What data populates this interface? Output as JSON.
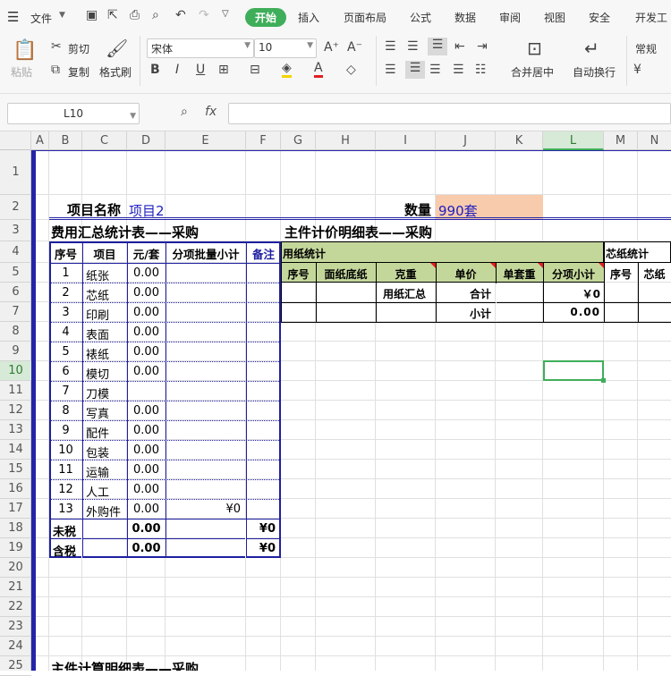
{
  "ribbon": {
    "file_menu": "文件",
    "tabs": [
      "开始",
      "插入",
      "页面布局",
      "公式",
      "数据",
      "审阅",
      "视图",
      "安全",
      "开发工"
    ],
    "paste_label": "粘贴",
    "cut_label": "剪切",
    "copy_label": "复制",
    "format_painter_label": "格式刷",
    "font_name": "宋体",
    "font_size": "10",
    "merge_label": "合并居中",
    "wrap_label": "自动换行",
    "number_format": "常规"
  },
  "formula_bar": {
    "name_box": "L10",
    "fx": "fx",
    "formula": ""
  },
  "columns": [
    "A",
    "B",
    "C",
    "D",
    "E",
    "F",
    "G",
    "H",
    "I",
    "J",
    "K",
    "L",
    "M",
    "N"
  ],
  "rows": [
    "1",
    "2",
    "3",
    "4",
    "5",
    "6",
    "7",
    "8",
    "9",
    "10",
    "11",
    "12",
    "13",
    "14",
    "15",
    "16",
    "17",
    "18",
    "19",
    "20",
    "21",
    "22",
    "23",
    "24",
    "25"
  ],
  "sheet": {
    "project_label": "项目名称",
    "project_value": "项目2",
    "qty_label": "数量",
    "qty_value": "990套",
    "summary_title": "费用汇总统计表——采购",
    "summary_headers": [
      "序号",
      "项目",
      "元/套",
      "分项批量小计",
      "备注"
    ],
    "summary_rows": [
      {
        "no": "1",
        "item": "纸张",
        "price": "0.00",
        "subtotal": ""
      },
      {
        "no": "2",
        "item": "芯纸",
        "price": "0.00",
        "subtotal": ""
      },
      {
        "no": "3",
        "item": "印刷",
        "price": "0.00",
        "subtotal": ""
      },
      {
        "no": "4",
        "item": "表面",
        "price": "0.00",
        "subtotal": ""
      },
      {
        "no": "5",
        "item": "裱纸",
        "price": "0.00",
        "subtotal": ""
      },
      {
        "no": "6",
        "item": "模切",
        "price": "0.00",
        "subtotal": ""
      },
      {
        "no": "7",
        "item": "刀模",
        "price": "",
        "subtotal": ""
      },
      {
        "no": "8",
        "item": "写真",
        "price": "0.00",
        "subtotal": ""
      },
      {
        "no": "9",
        "item": "配件",
        "price": "0.00",
        "subtotal": ""
      },
      {
        "no": "10",
        "item": "包装",
        "price": "0.00",
        "subtotal": ""
      },
      {
        "no": "11",
        "item": "运输",
        "price": "0.00",
        "subtotal": ""
      },
      {
        "no": "12",
        "item": "人工",
        "price": "0.00",
        "subtotal": ""
      },
      {
        "no": "13",
        "item": "外购件",
        "price": "0.00",
        "subtotal": "¥0"
      }
    ],
    "untaxed_label": "未税",
    "untaxed_price": "0.00",
    "untaxed_total": "¥0",
    "taxed_label": "含税",
    "taxed_price": "0.00",
    "taxed_total": "¥0",
    "detail_title": "主件计价明细表——采购",
    "paper_stats": "用纸统计",
    "core_stats": "芯纸统计",
    "detail_headers": [
      "序号",
      "面纸底纸",
      "克重",
      "单价",
      "单套重",
      "分项小计",
      "序号",
      "芯纸"
    ],
    "paper_summary": "用纸汇总",
    "sum_label": "合计",
    "sum_value": "￥0",
    "subtotal_label": "小计",
    "subtotal_value": "0.00",
    "bottom_title": "主件计算明细表——采购"
  },
  "colors": {
    "accent": "#3fae5a",
    "table_border": "#1f1fa0",
    "header_green": "#c4d79b",
    "qty_fill": "#f8cbad"
  }
}
